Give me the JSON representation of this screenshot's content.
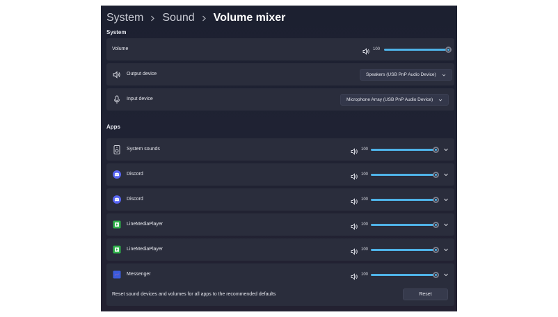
{
  "breadcrumb": {
    "items": [
      "System",
      "Sound",
      "Volume mixer"
    ]
  },
  "system_section": {
    "title": "System",
    "volume": {
      "label": "Volume",
      "value": "100",
      "level": 1.0
    },
    "output_device": {
      "label": "Output device",
      "selected": "Speakers (USB PnP Audio Device)"
    },
    "input_device": {
      "label": "Input device",
      "selected": "Microphone Array (USB PnP Audio Device)"
    }
  },
  "apps_section": {
    "title": "Apps",
    "apps": [
      {
        "name": "System sounds",
        "volume": "100",
        "icon": "system-sounds-icon",
        "color": "#3a3d4a"
      },
      {
        "name": "Discord",
        "volume": "100",
        "icon": "discord-icon",
        "color": "#5865f2"
      },
      {
        "name": "Discord",
        "volume": "100",
        "icon": "discord-icon",
        "color": "#5865f2"
      },
      {
        "name": "LineMediaPlayer",
        "volume": "100",
        "icon": "linemediaplayer-icon",
        "color": "#2fb24a"
      },
      {
        "name": "LineMediaPlayer",
        "volume": "100",
        "icon": "linemediaplayer-icon",
        "color": "#2fb24a"
      },
      {
        "name": "Messenger",
        "volume": "100",
        "icon": "messenger-icon",
        "color": "#3b5bdb"
      }
    ]
  },
  "reset": {
    "text": "Reset sound devices and volumes for all apps to the recommended defaults",
    "button_label": "Reset"
  },
  "colors": {
    "accent": "#4fb3e8",
    "card": "#2a2d3c",
    "background": "#1f2233"
  }
}
